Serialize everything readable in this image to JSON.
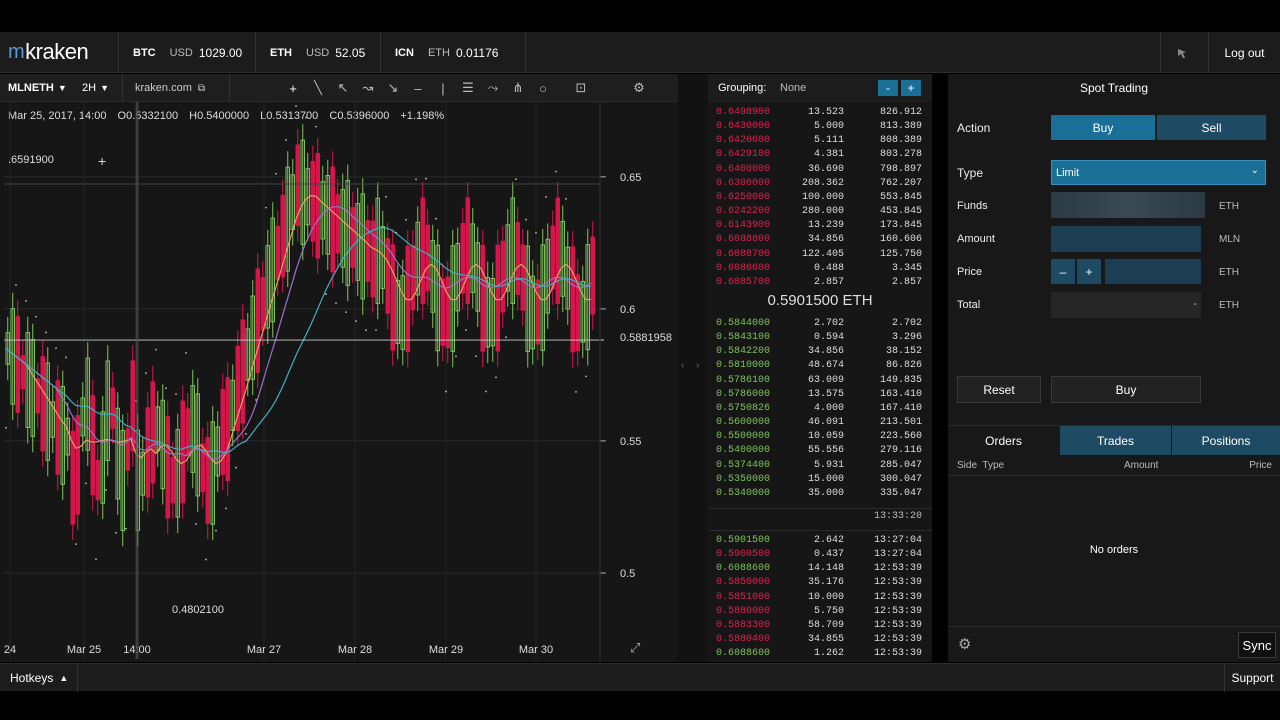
{
  "brand": {
    "logo_text": "kraken"
  },
  "tickers": [
    {
      "symbol": "BTC",
      "quote": "USD",
      "value": "1029.00"
    },
    {
      "symbol": "ETH",
      "quote": "USD",
      "value": "52.05"
    },
    {
      "symbol": "ICN",
      "quote": "ETH",
      "value": "0.01176"
    }
  ],
  "topbar": {
    "logout_label": "Log out"
  },
  "chart_toolbar": {
    "pair": "MLNETH",
    "interval": "2H",
    "source": "kraken.com"
  },
  "ohlc": {
    "date": "Mar 25, 2017, 14:00",
    "open_label": "O",
    "open": "0.5332100",
    "high_label": "H",
    "high": "0.5400000",
    "low_label": "L",
    "low": "0.5313700",
    "close_label": "C",
    "close": "0.5396000",
    "change": "+1.198%"
  },
  "chart_labels": {
    "crosshair_value": ".6591900",
    "current_price": "0.5881958",
    "low_marker": "0.4802100",
    "ylabels": [
      "0.65",
      "0.6",
      "0.55",
      "0.5"
    ],
    "xlabels": [
      "24",
      "Mar 25",
      "14:00",
      "Mar 27",
      "Mar 28",
      "Mar 29",
      "Mar 30"
    ]
  },
  "chart_data": {
    "type": "candlestick",
    "pair": "MLNETH",
    "interval": "2H",
    "ylim": [
      0.475,
      0.67
    ],
    "x_ticks": [
      "24",
      "Mar 25",
      "14:00",
      "Mar 27",
      "Mar 28",
      "Mar 29",
      "Mar 30"
    ],
    "y_ticks": [
      0.5,
      0.55,
      0.6,
      0.65
    ],
    "last_price": 0.5881958,
    "period_low": 0.48021,
    "selected_candle": {
      "date": "Mar 25, 2017, 14:00",
      "open": 0.53321,
      "high": 0.54,
      "low": 0.53137,
      "close": 0.5396,
      "change_pct": 1.198
    },
    "indicators": [
      "moving average (orange)",
      "moving average (purple)",
      "moving average (teal)",
      "parabolic SAR (dots)"
    ],
    "colors": {
      "up": "#7cc35a",
      "down": "#d8154a",
      "ma_fast": "#e8a060",
      "ma_mid": "#a070c8",
      "ma_slow": "#3fb0c0"
    }
  },
  "orderbook": {
    "grouping_label": "Grouping:",
    "grouping_value": "None",
    "asks": [
      [
        "0.6498900",
        "13.523",
        "826.912"
      ],
      [
        "0.6430000",
        "5.000",
        "813.389"
      ],
      [
        "0.6426600",
        "5.111",
        "808.389"
      ],
      [
        "0.6429100",
        "4.381",
        "803.278"
      ],
      [
        "0.6400000",
        "36.690",
        "798.897"
      ],
      [
        "0.6300000",
        "208.362",
        "762.207"
      ],
      [
        "0.6250000",
        "100.000",
        "553.845"
      ],
      [
        "0.6242200",
        "280.000",
        "453.845"
      ],
      [
        "0.6143900",
        "13.239",
        "173.845"
      ],
      [
        "0.6088800",
        "34.856",
        "160.606"
      ],
      [
        "0.6088700",
        "122.405",
        "125.750"
      ],
      [
        "0.6086600",
        "0.488",
        "3.345"
      ],
      [
        "0.6085700",
        "2.857",
        "2.857"
      ]
    ],
    "mid_price": "0.5901500",
    "mid_currency": "ETH",
    "bids": [
      [
        "0.5844000",
        "2.702",
        "2.702"
      ],
      [
        "0.5843100",
        "0.594",
        "3.296"
      ],
      [
        "0.5842200",
        "34.856",
        "38.152"
      ],
      [
        "0.5810000",
        "48.674",
        "86.826"
      ],
      [
        "0.5786100",
        "63.009",
        "149.835"
      ],
      [
        "0.5786000",
        "13.575",
        "163.410"
      ],
      [
        "0.5750826",
        "4.000",
        "167.410"
      ],
      [
        "0.5600000",
        "46.091",
        "213.501"
      ],
      [
        "0.5500000",
        "10.059",
        "223.560"
      ],
      [
        "0.5400000",
        "55.556",
        "279.116"
      ],
      [
        "0.5374400",
        "5.931",
        "285.047"
      ],
      [
        "0.5350000",
        "15.000",
        "300.047"
      ],
      [
        "0.5340000",
        "35.000",
        "335.047"
      ]
    ],
    "updated_time": "13:33:20",
    "trades": [
      [
        "0.5901500",
        "2.642",
        "13:27:04",
        "buy"
      ],
      [
        "0.5900500",
        "0.437",
        "13:27:04",
        "sell"
      ],
      [
        "0.6088600",
        "14.148",
        "12:53:39",
        "buy"
      ],
      [
        "0.5850000",
        "35.176",
        "12:53:39",
        "sell"
      ],
      [
        "0.5851000",
        "10.000",
        "12:53:39",
        "sell"
      ],
      [
        "0.5880000",
        "5.750",
        "12:53:39",
        "sell"
      ],
      [
        "0.5883300",
        "58.709",
        "12:53:39",
        "sell"
      ],
      [
        "0.5880400",
        "34.855",
        "12:53:39",
        "sell"
      ],
      [
        "0.6088600",
        "1.262",
        "12:53:39",
        "buy"
      ]
    ]
  },
  "spot": {
    "title": "Spot Trading",
    "action_label": "Action",
    "buy_label": "Buy",
    "sell_label": "Sell",
    "type_label": "Type",
    "type_value": "Limit",
    "funds_label": "Funds",
    "funds_unit": "ETH",
    "amount_label": "Amount",
    "amount_unit": "MLN",
    "price_label": "Price",
    "price_minus": "–",
    "price_plus": "+",
    "price_unit": "ETH",
    "total_label": "Total",
    "total_value": "-",
    "total_unit": "ETH",
    "reset_label": "Reset",
    "submit_label": "Buy",
    "tabs": [
      "Orders",
      "Trades",
      "Positions"
    ],
    "col_side_type": "Side  Type",
    "col_amount": "Amount",
    "col_price": "Price",
    "empty_text": "No orders",
    "sync_label": "Sync"
  },
  "footer": {
    "hotkeys_label": "Hotkeys",
    "support_label": "Support"
  },
  "colors": {
    "accent": "#1a6f96",
    "ask": "#e0204e",
    "bid": "#7cc35a",
    "panel": "#161616"
  }
}
